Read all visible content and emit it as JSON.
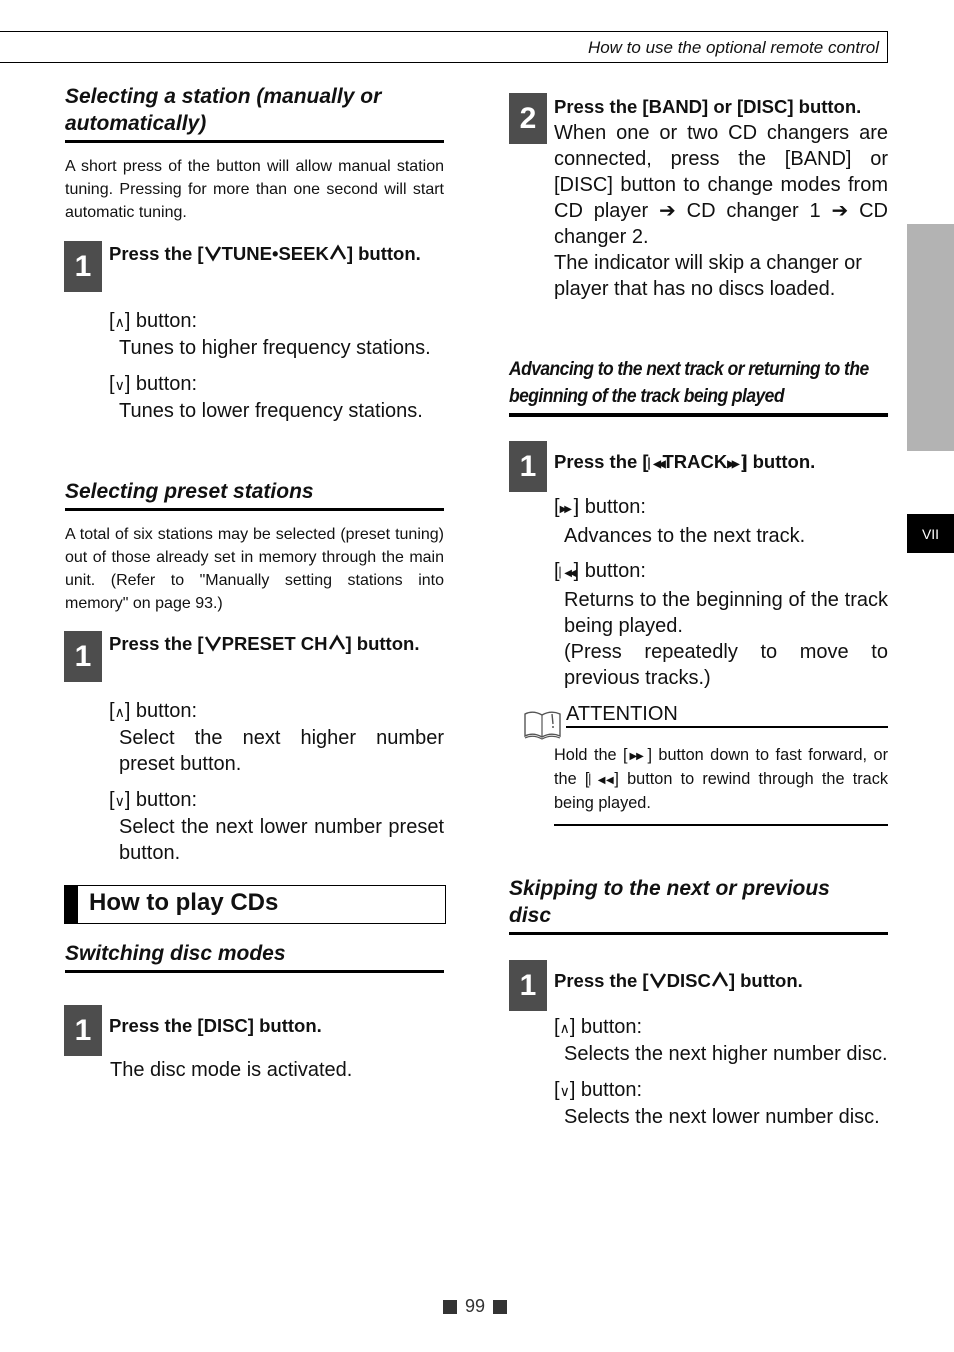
{
  "header": {
    "title": "How to use the optional remote control"
  },
  "side_tab": {
    "label": "VII"
  },
  "left": {
    "s1": {
      "title_l1": "Selecting a station (manually or",
      "title_l2": "automatically)",
      "intro": "A short press of the button will allow manual station tuning. Pressing for more than one second will start automatic tuning.",
      "step": {
        "num": "1",
        "pre": "Press the [",
        "button": "TUNE•SEEK",
        "post": "] button."
      },
      "up_label": "] button:",
      "up_desc": "Tunes to higher frequency stations.",
      "down_label": "] button:",
      "down_desc": "Tunes to lower frequency stations."
    },
    "s2": {
      "title": "Selecting preset stations",
      "intro": "A total of six stations may be selected (preset tuning) out of those already set in memory through the main unit. (Refer to \"Manually setting stations into memory\" on page 93.)",
      "step": {
        "num": "1",
        "pre": "Press the [",
        "button": "PRESET CH",
        "post": "] button."
      },
      "up_label": "] button:",
      "up_desc": "Select the next higher number preset button.",
      "down_label": "] button:",
      "down_desc": "Select the next lower number preset button."
    },
    "chapter": {
      "title": "How to play CDs"
    },
    "s3": {
      "title": "Switching disc modes",
      "step": {
        "num": "1",
        "text": "Press the [DISC] button."
      },
      "desc": "The disc mode is activated."
    }
  },
  "right": {
    "step2": {
      "num": "2",
      "text": "Press the [BAND] or [DISC] button.",
      "desc1": "When one or two CD changers are connected, press the [BAND] or [DISC] button to change modes from CD player ➔ CD changer 1 ➔ CD changer 2.",
      "desc2": "The indicator will skip a changer or player that has no discs loaded."
    },
    "s4": {
      "title_l1": "Advancing to the next track or returning to the",
      "title_l2": "beginning of the track being played",
      "step": {
        "num": "1",
        "pre": "Press the [",
        "button": "TRACK",
        "post": "] button."
      },
      "next_label": "] button:",
      "next_desc": "Advances to the next track.",
      "prev_label": "] button:",
      "prev_desc1": "Returns to the beginning of the track being played.",
      "prev_desc2": "(Press repeatedly to move to previous tracks.)"
    },
    "attention": {
      "title": "ATTENTION",
      "t1": "Hold the [",
      "t2": "] button down to fast forward, or the [",
      "t3": "] button to rewind through the track being played."
    },
    "s5": {
      "title_l1": "Skipping to the next or previous",
      "title_l2": "disc",
      "step": {
        "num": "1",
        "pre": "Press the [",
        "button": "DISC",
        "post": "] button."
      },
      "up_label": "] button:",
      "up_desc": "Selects the next higher number disc.",
      "down_label": "] button:",
      "down_desc": "Selects the next lower number disc."
    }
  },
  "footer": {
    "page": "99"
  }
}
